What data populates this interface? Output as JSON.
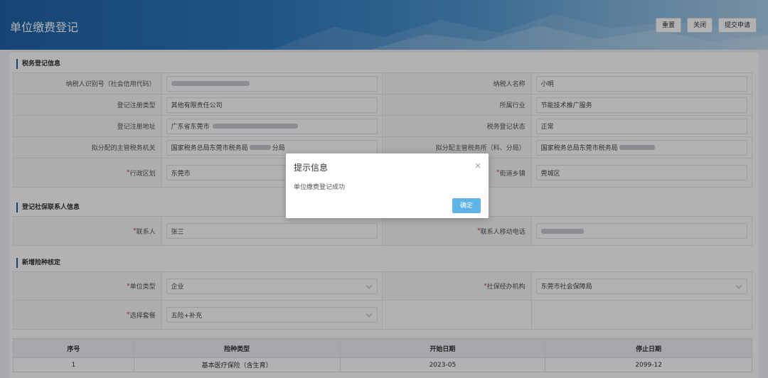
{
  "header": {
    "title": "单位缴费登记",
    "buttons": {
      "reset": "重置",
      "close": "关闭",
      "submit": "提交申请"
    }
  },
  "sections": {
    "tax_info": "税务登记信息",
    "contact_info": "登记社保联系人信息",
    "insurance": "新增险种核定"
  },
  "tax": {
    "taxpayer_id_label": "纳税人识别号（社会信用代码）",
    "taxpayer_name_label": "纳税人名称",
    "taxpayer_name": "小明",
    "reg_type_label": "登记注册类型",
    "reg_type": "其他有限责任公司",
    "industry_label": "所属行业",
    "industry": "节能技术推广服务",
    "reg_address_label": "登记注册地址",
    "reg_address_prefix": "广东省东莞市",
    "reg_status_label": "税务登记状态",
    "reg_status": "正常",
    "tax_authority_label": "拟分配的主管税务机关",
    "tax_authority_prefix": "国家税务总局东莞市税务局",
    "tax_authority_suffix": "分局",
    "tax_office_label": "拟分配主管税务所（科、分局）",
    "tax_office_prefix": "国家税务总局东莞市税务局",
    "district_label": "行政区划",
    "district": "东莞市",
    "street_label": "街道乡镇",
    "street": "莞城区"
  },
  "contact": {
    "name_label": "联系人",
    "name": "张三",
    "phone_label": "联系人移动电话"
  },
  "insurance": {
    "unit_type_label": "单位类型",
    "unit_type": "企业",
    "agency_label": "社保经办机构",
    "agency": "东莞市社会保障局",
    "package_label": "选择套餐",
    "package": "五险+补充"
  },
  "table": {
    "headers": [
      "序号",
      "险种类型",
      "开始日期",
      "停止日期"
    ],
    "rows": [
      [
        "1",
        "基本医疗保险（含生育）",
        "2023-05",
        "2099-12"
      ]
    ]
  },
  "dialog": {
    "title": "提示信息",
    "close_glyph": "×",
    "message": "单位缴费登记成功",
    "ok": "确定"
  },
  "required_mark": "*"
}
